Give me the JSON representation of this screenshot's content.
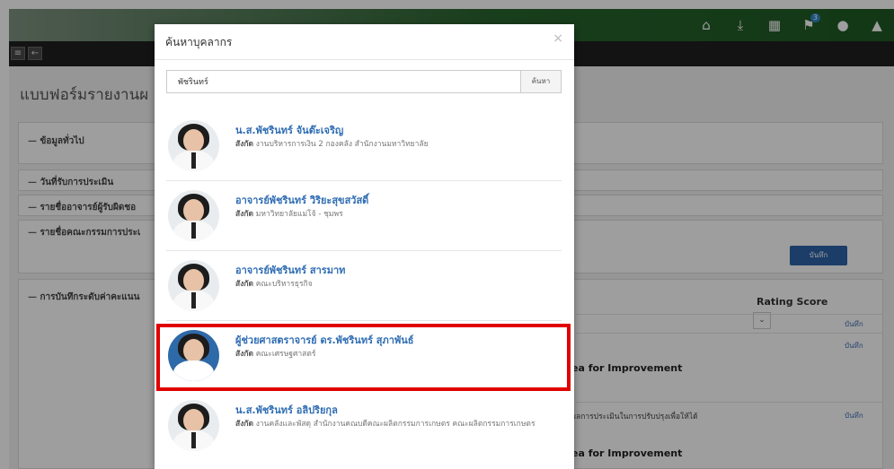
{
  "topbar": {
    "icons": [
      "home-icon",
      "download-icon",
      "calendar-icon",
      "bell-icon",
      "chat-icon",
      "user-icon"
    ],
    "notification_count": "3"
  },
  "page": {
    "title": "แบบฟอร์มรายงานผ",
    "sections": {
      "general": "ข้อมูลทั่วไป",
      "date": "วันที่รับการประเมิน",
      "advisor": "รายชื่ออาจารย์ผู้รับผิดชอ",
      "committee": "รายชื่อคณะกรรมการประเ",
      "rating": "การบันทึกระดับค่าคะแนน"
    },
    "save_button": "บันทึก",
    "rating_score": "Rating Score",
    "save_small": "บันทึก",
    "area_improvement": "ea for Improvement",
    "assessment_text": "ผลการประเมินในการปรับปรุงเพื่อให้ได้"
  },
  "modal": {
    "title": "ค้นหาบุคลากร",
    "close": "×",
    "search": {
      "value": "พัชรินทร์",
      "button": "ค้นหา"
    },
    "results": [
      {
        "name": "น.ส.พัชรินทร์ จันต๊ะเจริญ",
        "aff_label": "สังกัด",
        "affiliation": "งานบริหารการเงิน 2 กองคลัง สำนักงานมหาวิทยาลัย"
      },
      {
        "name": "อาจารย์พัชรินทร์ วิริยะสุขสวัสดิ์",
        "aff_label": "สังกัด",
        "affiliation": "มหาวิทยาลัยแม่โจ้ - ชุมพร"
      },
      {
        "name": "อาจารย์พัชรินทร์ สารมาท",
        "aff_label": "สังกัด",
        "affiliation": "คณะบริหารธุรกิจ"
      },
      {
        "name": "ผู้ช่วยศาสตราจารย์ ดร.พัชรินทร์ สุภาพันธ์",
        "aff_label": "สังกัด",
        "affiliation": "คณะเศรษฐศาสตร์"
      },
      {
        "name": "น.ส.พัชรินทร์ อลิปริยกุล",
        "aff_label": "สังกัด",
        "affiliation": "งานคลังและพัสดุ สำนักงานคณบดีคณะผลิตกรรมการเกษตร คณะผลิตกรรมการเกษตร"
      }
    ]
  },
  "colors": {
    "highlight": "#e00000",
    "link": "#2f6db3",
    "accent": "#2d63a8"
  }
}
